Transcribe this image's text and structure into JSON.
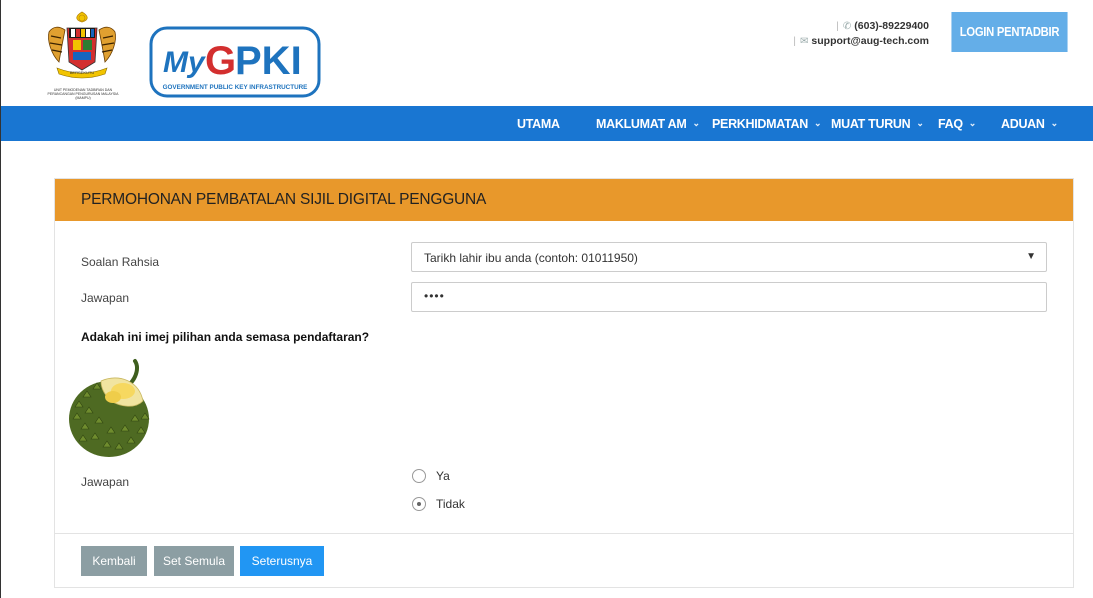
{
  "header": {
    "crest_caption": "UNIT PEMODENAN TADBIRAN DAN PERANCANGAN PENGURUSAN MALAYSIA (MAMPU)",
    "logo_brand": "MyGPKI",
    "logo_tagline": "GOVERNMENT PUBLIC KEY INFRASTRUCTURE",
    "phone": "(603)-89229400",
    "email": "support@aug-tech.com",
    "login_label": "LOGIN PENTADBIR",
    "phone_icon": "phone-icon",
    "mail_icon": "mail-icon"
  },
  "nav": {
    "items": [
      {
        "label": "UTAMA",
        "has_dropdown": false
      },
      {
        "label": "MAKLUMAT AM",
        "has_dropdown": true
      },
      {
        "label": "PERKHIDMATAN",
        "has_dropdown": true
      },
      {
        "label": "MUAT TURUN",
        "has_dropdown": true
      },
      {
        "label": "FAQ",
        "has_dropdown": true
      },
      {
        "label": "ADUAN",
        "has_dropdown": true
      }
    ],
    "chevron": "⌄"
  },
  "form": {
    "title": "PERMOHONAN PEMBATALAN SIJIL DIGITAL PENGGUNA",
    "secret_question_label": "Soalan Rahsia",
    "secret_question_value": "Tarikh lahir ibu anda (contoh: 01011950)",
    "answer_label": "Jawapan",
    "answer_value": "••••",
    "image_question": "Adakah ini imej pilihan anda semasa pendaftaran?",
    "image_answer_label": "Jawapan",
    "options": [
      {
        "label": "Ya",
        "checked": false
      },
      {
        "label": "Tidak",
        "checked": true
      }
    ],
    "buttons": {
      "back": "Kembali",
      "reset": "Set Semula",
      "next": "Seterusnya"
    }
  },
  "colors": {
    "nav_bg": "#1976d2",
    "panel_header": "#e8982b",
    "login_button": "#64aee8",
    "primary_button": "#2196f3",
    "secondary_button": "#8c9ea3"
  }
}
